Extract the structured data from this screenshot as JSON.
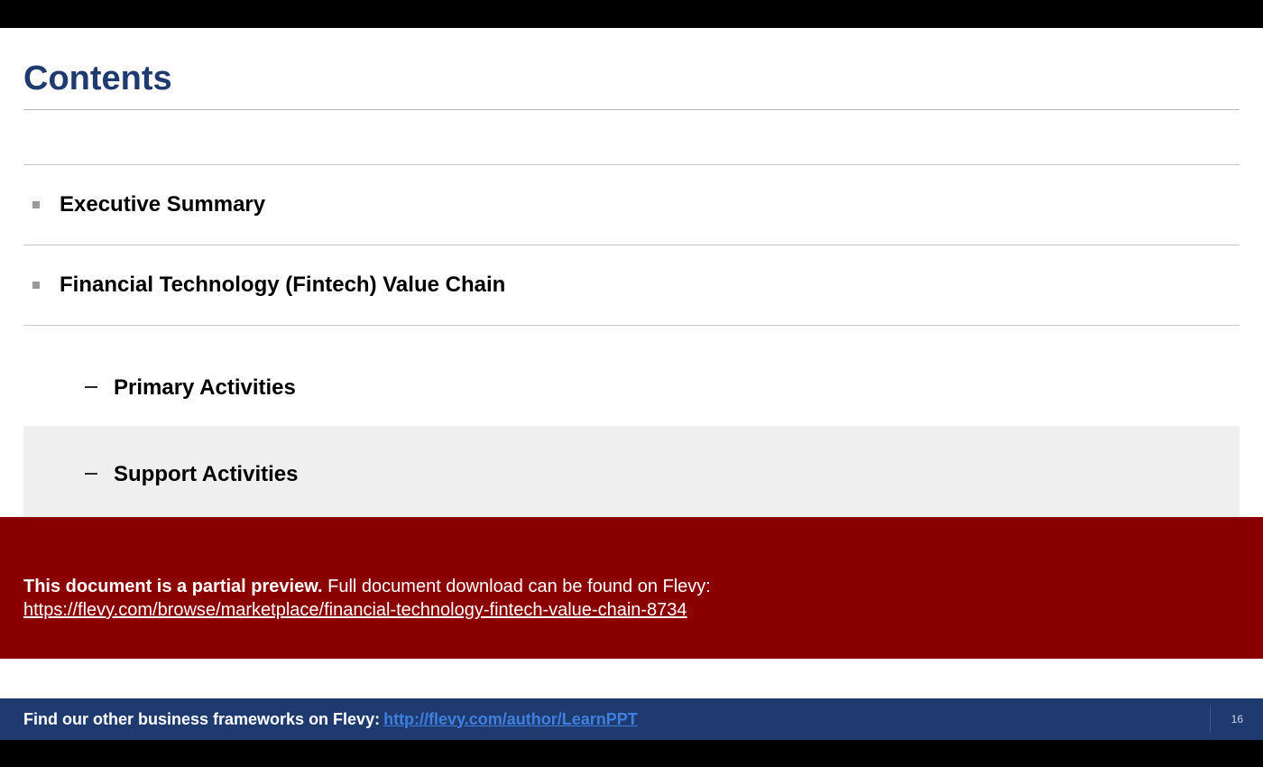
{
  "title": "Contents",
  "toc": {
    "item0": {
      "label": "Executive Summary"
    },
    "item1": {
      "label": "Financial Technology (Fintech) Value Chain"
    },
    "sub0": {
      "label": "Primary Activities"
    },
    "sub1": {
      "label": "Support Activities"
    }
  },
  "preview": {
    "bold": "This document is a partial preview.",
    "rest": "  Full document download can be found on Flevy:",
    "url_text": "https://flevy.com/browse/marketplace/financial-technology-fintech-value-chain-8734"
  },
  "footer": {
    "text": "Find our other business frameworks on Flevy:",
    "link_text": "http://flevy.com/author/LearnPPT",
    "page_number": "16"
  }
}
